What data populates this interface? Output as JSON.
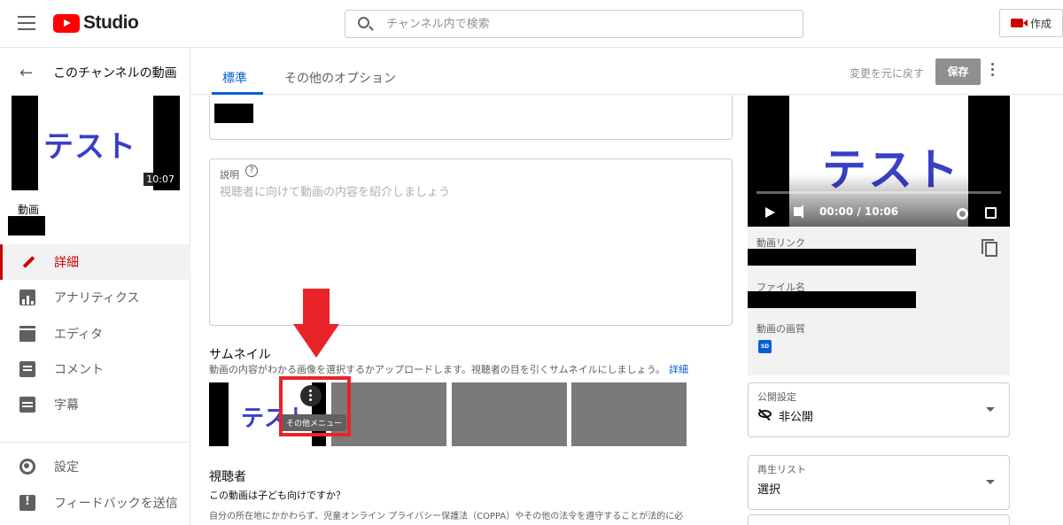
{
  "topbar": {
    "studio_label": "Studio",
    "search_placeholder": "チャンネル内で検索",
    "create_label": "作成"
  },
  "sidebar": {
    "back_label": "このチャンネルの動画",
    "thumbnail_text": "テスト",
    "duration": "10:07",
    "video_label": "動画",
    "nav": [
      {
        "label": "詳細",
        "icon": "pencil-icon",
        "active": true
      },
      {
        "label": "アナリティクス",
        "icon": "analytics-icon"
      },
      {
        "label": "エディタ",
        "icon": "editor-icon"
      },
      {
        "label": "コメント",
        "icon": "comment-icon"
      },
      {
        "label": "字幕",
        "icon": "subtitles-icon"
      }
    ],
    "bottom": [
      {
        "label": "設定",
        "icon": "gear-icon"
      },
      {
        "label": "フィードバックを送信",
        "icon": "feedback-icon"
      }
    ]
  },
  "header": {
    "tabs": [
      {
        "label": "標準",
        "active": true
      },
      {
        "label": "その他のオプション"
      }
    ],
    "undo_label": "変更を元に戻す",
    "save_label": "保存"
  },
  "form": {
    "description_label": "説明",
    "description_placeholder": "視聴者に向けて動画の内容を紹介しましょう",
    "thumbnail_heading": "サムネイル",
    "thumbnail_desc": "動画の内容がわかる画像を選択するかアップロードします。視聴者の目を引くサムネイルにしましょう。",
    "thumbnail_link": "詳細",
    "thumbnail_text": "テスト",
    "tooltip": "その他メニュー",
    "audience_heading": "視聴者",
    "audience_question": "この動画は子ども向けですか？",
    "audience_text": "自分の所在地にかかわらず、児童オンライン プライバシー保護法（COPPA）やその他の法令を遵守することが法的に必"
  },
  "preview": {
    "video_text": "テスト",
    "time": "00:00 / 10:06",
    "link_label": "動画リンク",
    "file_label": "ファイル名",
    "quality_label": "動画の画質",
    "quality_badge": "SD"
  },
  "visibility": {
    "label": "公開設定",
    "value": "非公開"
  },
  "playlist": {
    "label": "再生リスト",
    "value": "選択"
  },
  "colors": {
    "accent": "#065fd4",
    "brand": "#ff0000",
    "active_nav": "#cc0000",
    "annotation": "#e8232a"
  }
}
